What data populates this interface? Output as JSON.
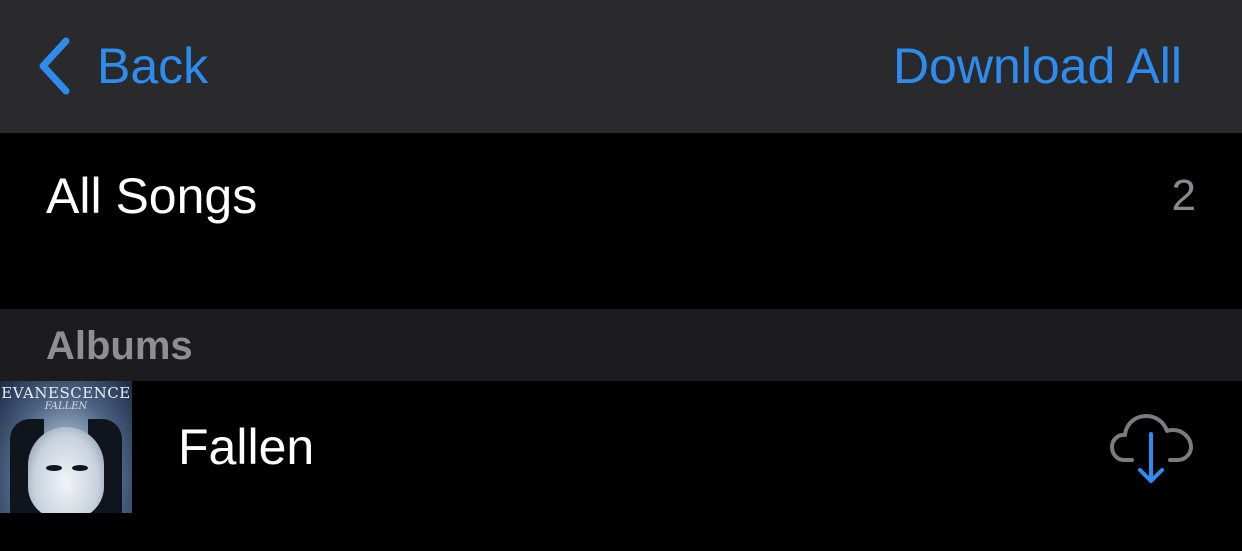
{
  "navbar": {
    "back_label": "Back",
    "download_all_label": "Download All"
  },
  "all_songs": {
    "label": "All Songs",
    "count": "2"
  },
  "albums_section": {
    "title": "Albums",
    "items": [
      {
        "title": "Fallen",
        "artwork": {
          "brand_text": "EVANESCENCE",
          "sub_text": "FALLEN"
        },
        "download_icon": "cloud-download-icon"
      }
    ]
  },
  "colors": {
    "accent": "#2d8cf0",
    "navbar_bg": "#2a2a2c",
    "section_bg": "#1c1c1e",
    "secondary_text": "#8e8e93"
  }
}
